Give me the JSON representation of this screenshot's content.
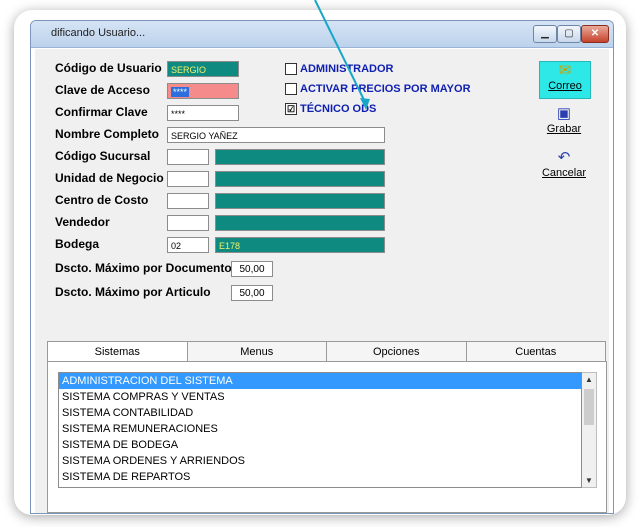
{
  "window": {
    "title": "dificando Usuario..."
  },
  "form": {
    "codigo_usuario": {
      "label": "Código de Usuario",
      "value": "SERGIO"
    },
    "clave_acceso": {
      "label": "Clave de Acceso",
      "value": "****"
    },
    "confirmar_clave": {
      "label": "Confirmar Clave",
      "value": "****"
    },
    "nombre_completo": {
      "label": "Nombre Completo",
      "value": "SERGIO YAÑEZ"
    },
    "codigo_sucursal": {
      "label": "Código Sucursal",
      "code": "",
      "desc": ""
    },
    "unidad_negocio": {
      "label": "Unidad de Negocio",
      "code": "",
      "desc": ""
    },
    "centro_costo": {
      "label": "Centro de Costo",
      "code": "",
      "desc": ""
    },
    "vendedor": {
      "label": "Vendedor",
      "code": "",
      "desc": ""
    },
    "bodega": {
      "label": "Bodega",
      "code": "02",
      "desc": "E178"
    },
    "dscto_documento": {
      "label": "Dscto. Máximo por Documento",
      "value": "50,00"
    },
    "dscto_articulo": {
      "label": "Dscto. Máximo por Articulo",
      "value": "50,00"
    }
  },
  "checks": [
    {
      "label": "ADMINISTRADOR",
      "checked": false
    },
    {
      "label": "ACTIVAR PRECIOS POR MAYOR",
      "checked": false
    },
    {
      "label": "TÉCNICO ODS",
      "checked": true
    }
  ],
  "check_glyph": "☑",
  "side": {
    "correo": {
      "label": "Correo",
      "icon": "envelope-icon"
    },
    "grabar": {
      "label": "Grabar",
      "icon": "floppy-icon"
    },
    "cancelar": {
      "label": "Cancelar",
      "icon": "undo-icon"
    }
  },
  "tabs": [
    "Sistemas",
    "Menus",
    "Opciones",
    "Cuentas"
  ],
  "systems": [
    "ADMINISTRACION DEL SISTEMA",
    "SISTEMA COMPRAS Y VENTAS",
    "SISTEMA CONTABILIDAD",
    "SISTEMA REMUNERACIONES",
    "SISTEMA DE BODEGA",
    "SISTEMA ORDENES Y ARRIENDOS",
    "SISTEMA DE REPARTOS"
  ],
  "colors": {
    "teal": "#0e8a80",
    "arrow": "#1aa6c8",
    "selection": "#3399ff"
  }
}
